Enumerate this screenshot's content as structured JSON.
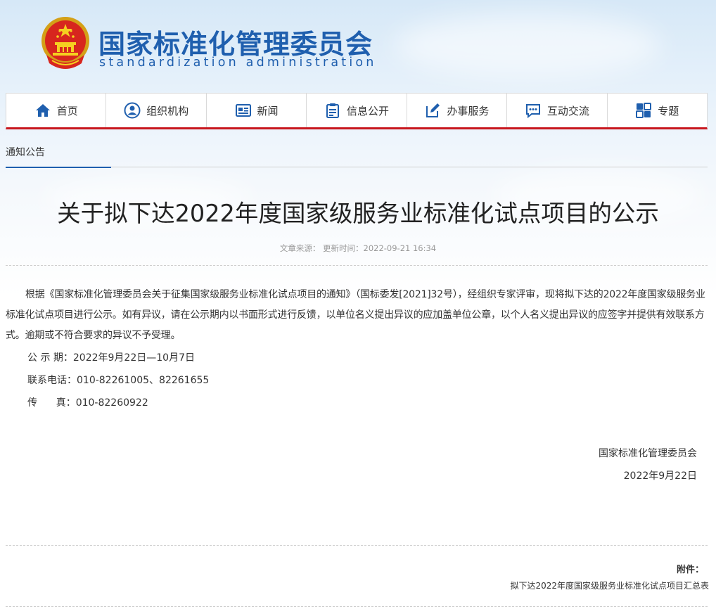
{
  "header": {
    "title": "国家标准化管理委员会",
    "subtitle": "standardization administration"
  },
  "nav": {
    "items": [
      {
        "label": "首页",
        "icon": "home-icon"
      },
      {
        "label": "组织机构",
        "icon": "person-icon"
      },
      {
        "label": "新闻",
        "icon": "newspaper-icon"
      },
      {
        "label": "信息公开",
        "icon": "clipboard-icon"
      },
      {
        "label": "办事服务",
        "icon": "edit-icon"
      },
      {
        "label": "互动交流",
        "icon": "chat-icon"
      },
      {
        "label": "专题",
        "icon": "topic-icon"
      }
    ]
  },
  "breadcrumb": {
    "label": "通知公告"
  },
  "article": {
    "title": "关于拟下达2022年度国家级服务业标准化试点项目的公示",
    "meta": "文章来源：  更新时间：2022-09-21 16:34",
    "paragraph": "根据《国家标准化管理委员会关于征集国家级服务业标准化试点项目的通知》（国标委发[2021]32号），经组织专家评审，现将拟下达的2022年度国家级服务业标准化试点项目进行公示。如有异议，请在公示期内以书面形式进行反馈，以单位名义提出异议的应加盖单位公章，以个人名义提出异议的应签字并提供有效联系方式。逾期或不符合要求的异议不予受理。",
    "period": "公 示 期：2022年9月22日—10月7日",
    "phone": "联系电话：010-82261005、82261655",
    "fax": "传      真：010-82260922",
    "signature_org": "国家标准化管理委员会",
    "signature_date": "2022年9月22日"
  },
  "attachment": {
    "label": "附件：",
    "link": "拟下达2022年度国家级服务业标准化试点项目汇总表"
  },
  "colors": {
    "brand_blue": "#1f5fae",
    "accent_red": "#c8161d"
  }
}
